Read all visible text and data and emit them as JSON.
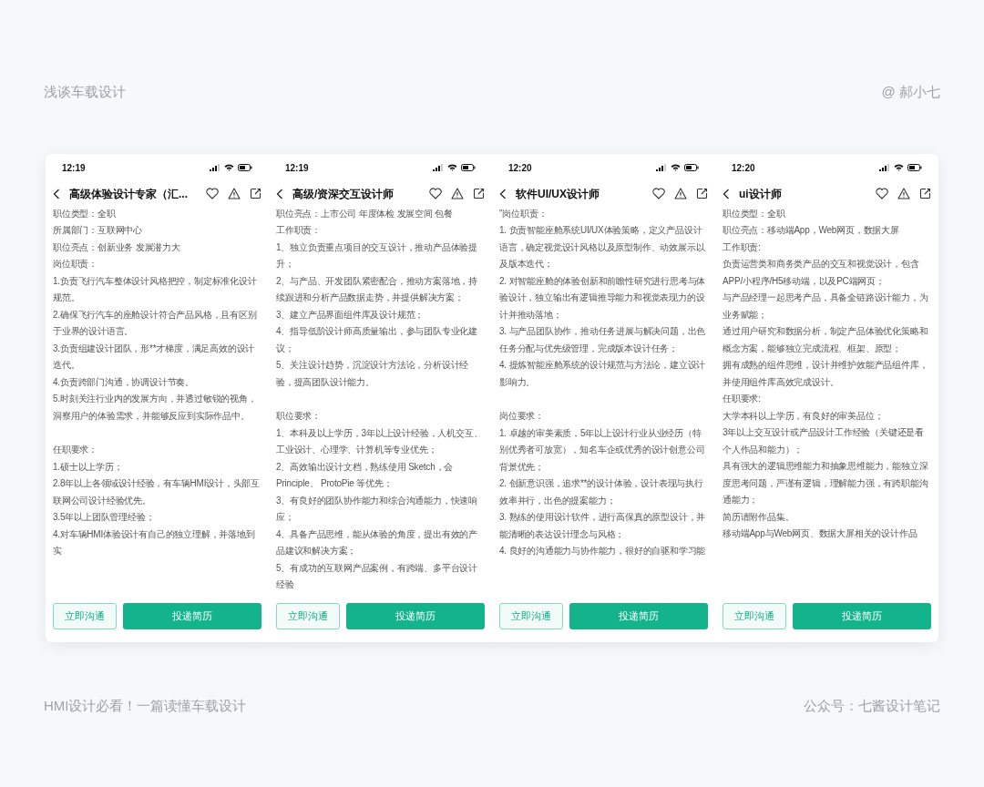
{
  "header": {
    "left": "浅谈车载设计",
    "right": "@ 郝小七"
  },
  "phones": [
    {
      "time": "12:19",
      "title": "高级体验设计专家（汇...",
      "sections": [
        [
          "职位类型：全职",
          "所属部门：互联网中心",
          "职位亮点：创新业务 发展潜力大",
          "岗位职责：",
          "1.负责飞行汽车整体设计风格把控，制定标准化设计规范。",
          "2.确保飞行汽车的座舱设计符合产品风格，且有区别于业界的设计语言。",
          "3.负责组建设计团队，形**才梯度，满足高效的设计迭代。",
          "4.负责跨部门沟通，协调设计节奏。",
          "5.时刻关注行业内的发展方向，并透过敏锐的视角，洞察用户的体验需求，并能够反应到实际作品中。"
        ],
        [
          "任职要求：",
          "1.硕士以上学历；",
          "2.8年以上各领域设计经验，有车辆HMI设计，头部互联网公司设计经验优先。",
          "3.5年以上团队管理经验；",
          "4.对车辆HMI体验设计有自己的独立理解，并落地到实"
        ]
      ],
      "chat": "立即沟通",
      "apply": "投递简历"
    },
    {
      "time": "12:19",
      "title": "高级/资深交互设计师",
      "sections": [
        [
          "职位亮点：上市公司 年度体检 发展空间 包餐",
          "工作职责：",
          "1、独立负责重点项目的交互设计，推动产品体验提升；",
          "2、与产品、开发团队紧密配合，推动方案落地，持续跟进和分析产品数据走势，并提供解决方案；",
          "3、建立产品界面组件库及设计规范；",
          "4、指导低阶设计师高质量输出，参与团队专业化建议；",
          "5、关注设计趋势，沉淀设计方法论，分析设计经验，提高团队设计能力。"
        ],
        [
          "职位要求：",
          "1、本科及以上学历，3年以上设计经验，人机交互、工业设计、心理学、计算机等专业优先；",
          "2、高效输出设计文档，熟练使用 Sketch，会 Principle、 ProtoPie 等优先；",
          "3、有良好的团队协作能力和综合沟通能力，快速响应；",
          "4、具备产品思维，能从体验的角度，提出有效的产品建议和解决方案；",
          "5、有成功的互联网产品案例，有跨端、多平台设计经验"
        ]
      ],
      "chat": "立即沟通",
      "apply": "投递简历"
    },
    {
      "time": "12:20",
      "title": "软件UI/UX设计师",
      "sections": [
        [
          "\"岗位职责：",
          "1. 负责智能座舱系统UI/UX体验策略，定义产品设计语言，确定视觉设计风格以及原型制作、动效展示以及版本迭代；",
          "2. 对智能座舱的体验创新和前瞻性研究进行思考与体验设计，独立输出有逻辑推导能力和视觉表现力的设计并推动落地；",
          "3. 与产品团队协作，推动任务进展与解决问题，出色任务分配与优先级管理，完成版本设计任务；",
          "4. 提炼智能座舱系统的设计规范与方法论，建立设计影响力。"
        ],
        [
          "岗位要求：",
          "1. 卓越的审美素质，5年以上设计行业从业经历（特别优秀者可放宽），知名车企或优秀的设计创意公司背景优先；",
          "2. 创新意识强，追求**的设计体验，设计表现与执行效率并行，出色的提案能力；",
          "3. 熟练的使用设计软件，进行高保真的原型设计，并能清晰的表达设计理念与风格；",
          "4. 良好的沟通能力与协作能力，很好的自驱和学习能"
        ]
      ],
      "chat": "立即沟通",
      "apply": "投递简历"
    },
    {
      "time": "12:20",
      "title": "ui设计师",
      "sections": [
        [
          "职位类型：全职",
          "职位亮点：移动端App，Web网页，数据大屏",
          "工作职责:",
          "负责运营类和商务类产品的交互和视觉设计，包含APP/小程序/H5移动端，以及PC端网页；",
          "与产品经理一起思考产品，具备全链路设计能力，为业务赋能；",
          "通过用户研究和数据分析，制定产品体验优化策略和概念方案，能够独立完成流程、框架、原型；",
          "拥有成熟的组件思维，设计并维护效能产品组件库，并使用组件库高效完成设计。",
          "任职要求:",
          "大学本科以上学历，有良好的审美品位；",
          "3年以上交互设计或产品设计工作经验（关键还是看个人作品和能力）；",
          "具有强大的逻辑思维能力和抽象思维能力，能独立深度思考问题，严谨有逻辑，理解能力强，有跨职能沟通能力；",
          "简历请附作品集。",
          "移动端App与Web网页、数据大屏相关的设计作品"
        ]
      ],
      "chat": "立即沟通",
      "apply": "投递简历"
    }
  ],
  "footer": {
    "left": "HMI设计必看！一篇读懂车载设计",
    "right": "公众号：七酱设计笔记"
  }
}
